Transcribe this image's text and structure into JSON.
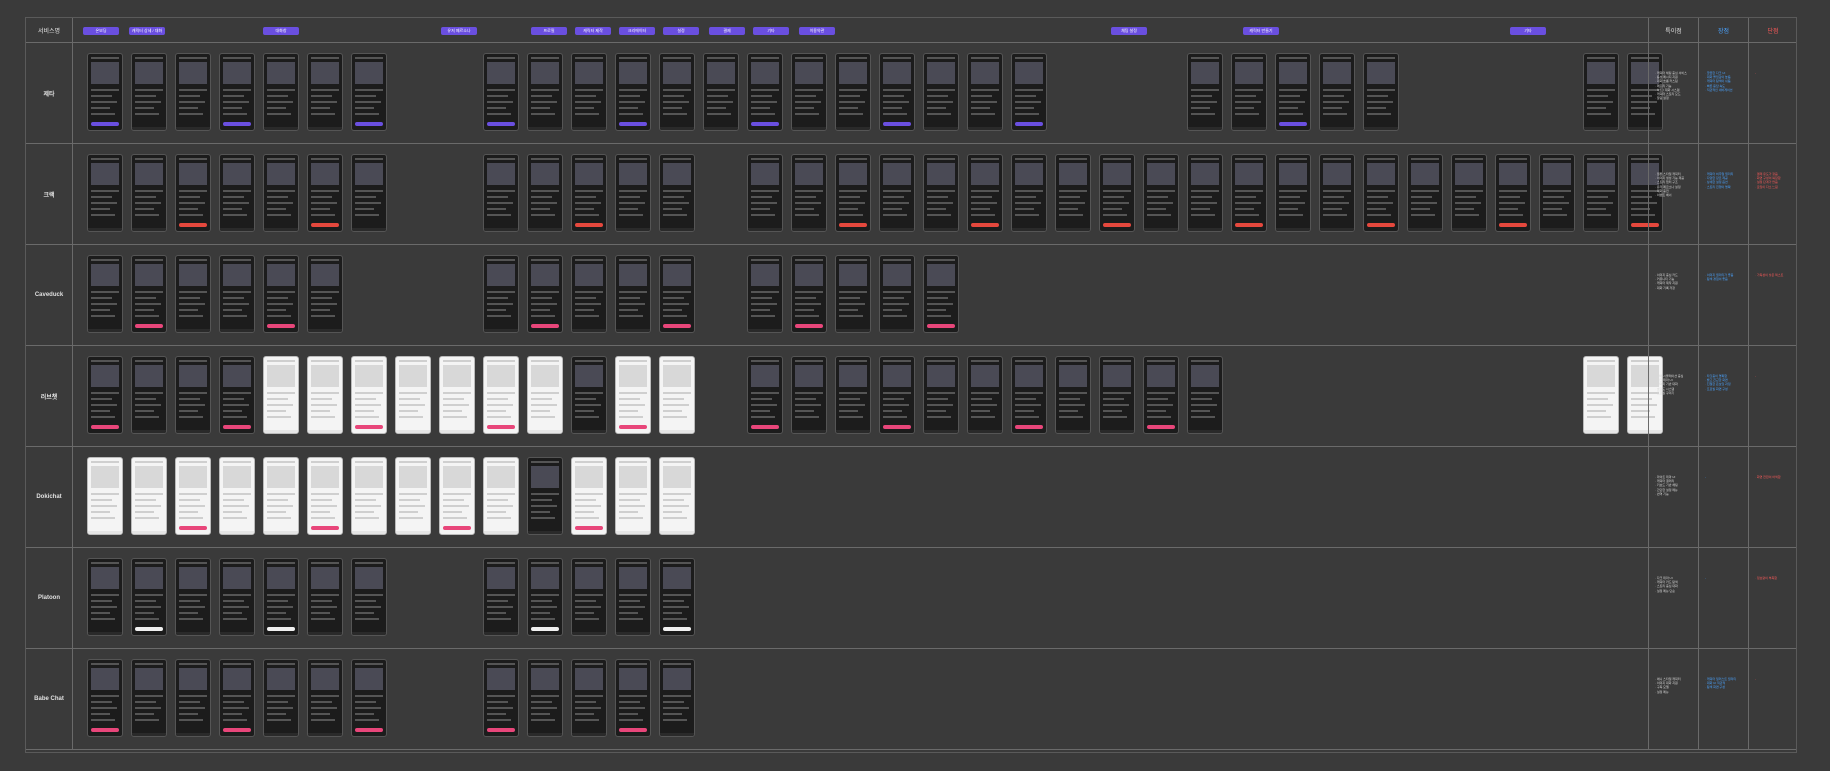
{
  "header": {
    "service_label": "서비스명",
    "tags": [
      "온보딩",
      "캐릭터 상세 / 대화",
      "대화창",
      "유저 페르소나",
      "프로필",
      "캐릭터 제작",
      "크리에이터",
      "설정",
      "결제",
      "기타",
      "이용약관",
      "채팅 설정",
      "캐릭터 만들기"
    ],
    "features_label": "특이점",
    "pros_label": "장점",
    "cons_label": "단점"
  },
  "colors": {
    "tag": "#6a4fe0",
    "pros": "#4aa3ff",
    "cons": "#ff5a5a",
    "zeta_accent": "#6a4fe0",
    "pink_accent": "#e8467a",
    "crack_accent": "#e5483d"
  },
  "rows": [
    {
      "label": "제타",
      "features": "· 캐릭터 채팅 중심 서비스\n· 음성 메시지 지원\n· 대화 흐름 커스텀\n· 메모리 기능\n· 하트 / 재화 시스템\n· 캐릭터 스토리 모드\n· 알림 설정",
      "pros": "· 깔끔한 다크 UI\n· 대화 몰입감이 높음\n· 캐릭터 탐색이 쉬움\n· 빠른 응답 속도\n· 직관적인 네비게이션",
      "cons": "-"
    },
    {
      "label": "크랙",
      "features": "· 웹툰 스타일 캐릭터\n· 이미지 생성 기능 제공\n· 스토리 챕터 구조\n· 유저 페르소나 설정\n· 재화 충전\n· 이벤트 배너",
      "pros": "· 캐릭터 비주얼 퀄리티\n· 다양한 장르 제공\n· 상세한 설정 옵션\n· 스토리 진행이 명확",
      "cons": "· 결제 유도가 잦음\n· 화면 구성이 복잡함\n· 설정 단계가 많음\n· 로딩이 다소 느림"
    },
    {
      "label": "Caveduck",
      "features": "· 이미지 중심 카드\n· 커뮤니티 기능\n· 캐릭터 제작 지원\n· 대화 기록 저장",
      "pros": "· 이미지 퀄리티가 좋음\n· 탐색 경험이 좋음",
      "cons": "· 가독성이 낮은 텍스트"
    },
    {
      "label": "러브챗",
      "features": "· 연애 시뮬레이션 중심\n· 핑크 테마 UI\n· 선택지 기반 대화\n· 호감도 시스템\n· 프로필 꾸미기",
      "pros": "· 타깃층이 명확함\n· 밝고 친근한 화면\n· 친절한 온보딩 과정\n· 프로필 화면 구성",
      "cons": "-"
    },
    {
      "label": "Dokichat",
      "features": "· 라이트 테마 UI\n· 캐릭터 갤러리\n· 키보드 기반 채팅\n· 간단한 설정 메뉴\n· 번역 기능",
      "pros": "-",
      "cons": "· 화면 전환이 어색함"
    },
    {
      "label": "Platoon",
      "features": "· 다크 테마 UI\n· 캐릭터 카드 탐색\n· 스토리 중심 대화\n· 설정 메뉴 단순",
      "pros": "-",
      "cons": "· 정보량이 부족함"
    },
    {
      "label": "Babe Chat",
      "features": "· 애니 스타일 캐릭터\n· 이미지 대화 지원\n· 구독 모델\n· 설정 메뉴",
      "pros": "· 캐릭터 일러스트 퀄리티\n· 대화 UI 직관적\n· 탐색 화면 구성",
      "cons": "-"
    }
  ]
}
